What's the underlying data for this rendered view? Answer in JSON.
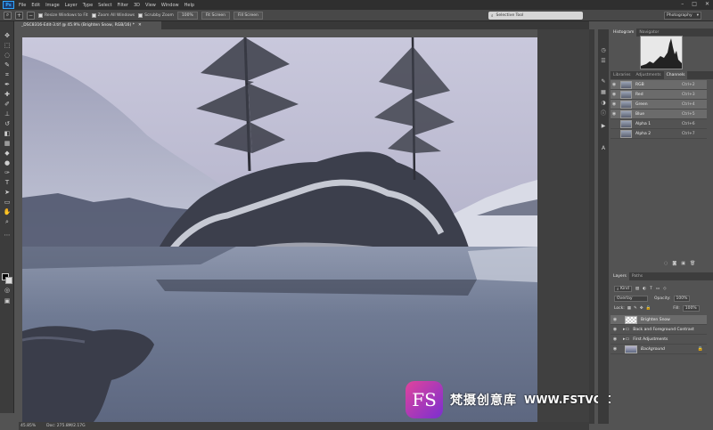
{
  "app": {
    "logo": "Ps"
  },
  "menu": [
    "File",
    "Edit",
    "Image",
    "Layer",
    "Type",
    "Select",
    "Filter",
    "3D",
    "View",
    "Window",
    "Help"
  ],
  "options": {
    "resize_windows": "Resize Windows to Fit",
    "zoom_all": "Zoom All Windows",
    "scrubby_zoom": "Scrubby Zoom",
    "zoom_pct": "100%",
    "fit_screen": "Fit Screen",
    "fill_screen": "Fill Screen",
    "search": "Selective Tool",
    "workspace": "Photography"
  },
  "document": {
    "tab_title": "_DSC8316-Edit-3.tif @ 45.9% (Brighten Snow, RGB/16) *",
    "zoom": "45.85%",
    "doc_size": "Doc: 275.8M/2.17G"
  },
  "panels": {
    "histogram_tabs": [
      "Histogram",
      "Navigator"
    ],
    "channel_tabs": [
      "Libraries",
      "Adjustments",
      "Channels"
    ],
    "channels": [
      {
        "name": "RGB",
        "shortcut": "Ctrl+2"
      },
      {
        "name": "Red",
        "shortcut": "Ctrl+3"
      },
      {
        "name": "Green",
        "shortcut": "Ctrl+4"
      },
      {
        "name": "Blue",
        "shortcut": "Ctrl+5"
      },
      {
        "name": "Alpha 1",
        "shortcut": "Ctrl+6"
      },
      {
        "name": "Alpha 2",
        "shortcut": "Ctrl+7"
      }
    ],
    "layer_tabs": [
      "Layers",
      "Paths"
    ],
    "kind": "Kind",
    "blend_mode": "Overlay",
    "opacity_label": "Opacity:",
    "opacity": "100%",
    "lock_label": "Lock:",
    "fill_label": "Fill:",
    "fill": "100%",
    "layers": [
      {
        "name": "Brighten Snow"
      },
      {
        "name": "Back and Foreground Contrast"
      },
      {
        "name": "First Adjustments"
      },
      {
        "name": "Background"
      }
    ]
  },
  "watermark": {
    "logo": "FS",
    "text": "梵摄创意库",
    "url": "WWW.FSTVC.CC"
  },
  "colors": {
    "ui_dark": "#2f2f2f",
    "panel": "#535353",
    "selected": "#6b6b6b",
    "accent": "#31a8ff"
  }
}
